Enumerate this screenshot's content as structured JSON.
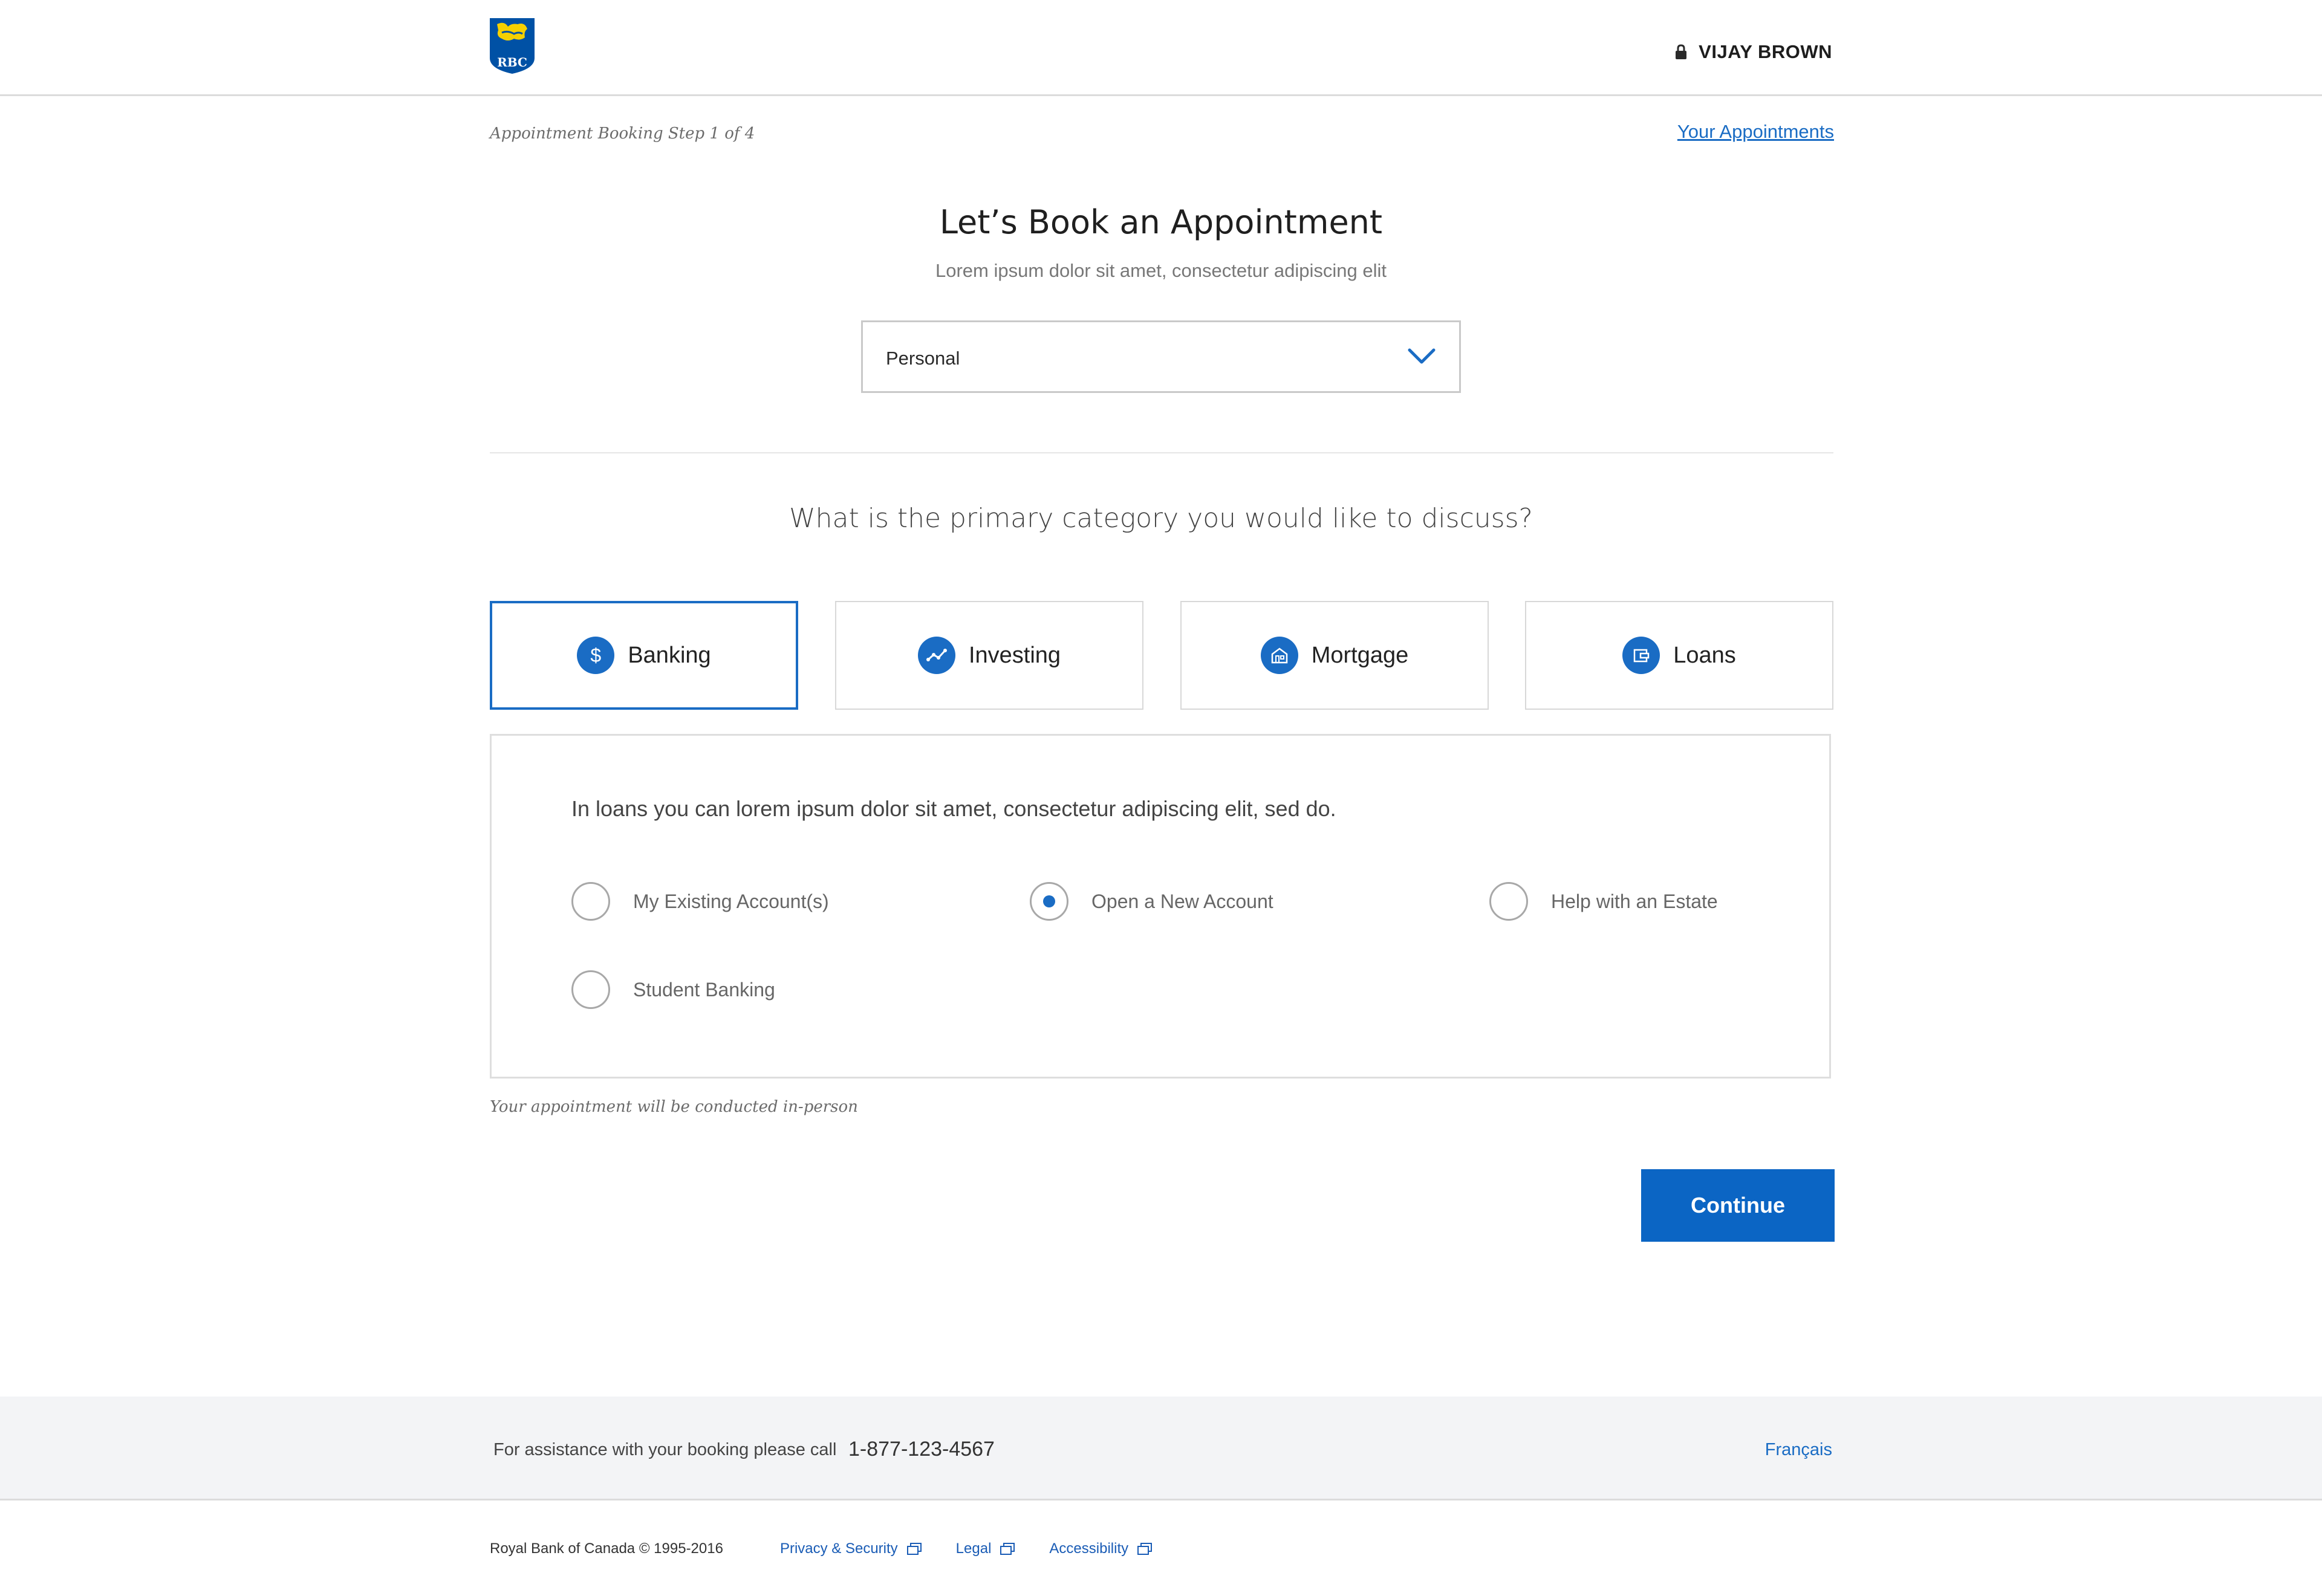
{
  "header": {
    "logo_text": "RBC",
    "user_name": "VIJAY BROWN"
  },
  "step_text": "Appointment Booking Step 1 of 4",
  "your_appointments_link": "Your Appointments",
  "title": "Let’s Book an Appointment",
  "subtitle": "Lorem ipsum dolor sit amet, consectetur adipiscing elit",
  "account_type_select": {
    "value": "Personal"
  },
  "question": "What is the primary category you would like to discuss?",
  "categories": [
    {
      "label": "Banking",
      "icon": "dollar-icon",
      "selected": true
    },
    {
      "label": "Investing",
      "icon": "trend-icon",
      "selected": false
    },
    {
      "label": "Mortgage",
      "icon": "house-icon",
      "selected": false
    },
    {
      "label": "Loans",
      "icon": "wallet-icon",
      "selected": false
    }
  ],
  "panel": {
    "description": "In loans you can lorem ipsum dolor sit amet, consectetur adipiscing elit, sed do.",
    "options": [
      {
        "label": "My Existing Account(s)",
        "checked": false
      },
      {
        "label": "Open a New Account",
        "checked": true
      },
      {
        "label": "Help with an Estate",
        "checked": false
      },
      {
        "label": "Student Banking",
        "checked": false
      }
    ]
  },
  "in_person_note": "Your appointment will be conducted in-person",
  "continue_label": "Continue",
  "footer": {
    "assist_text": "For assistance with your booking please call",
    "phone": "1-877-123-4567",
    "language_link": "Français",
    "copyright": "Royal Bank of Canada © 1995-2016",
    "links": [
      "Privacy & Security",
      "Legal",
      "Accessibility"
    ]
  },
  "colors": {
    "brand_blue": "#0b65c4",
    "link_blue": "#1a6cc4",
    "logo_gold": "#f5d000"
  }
}
